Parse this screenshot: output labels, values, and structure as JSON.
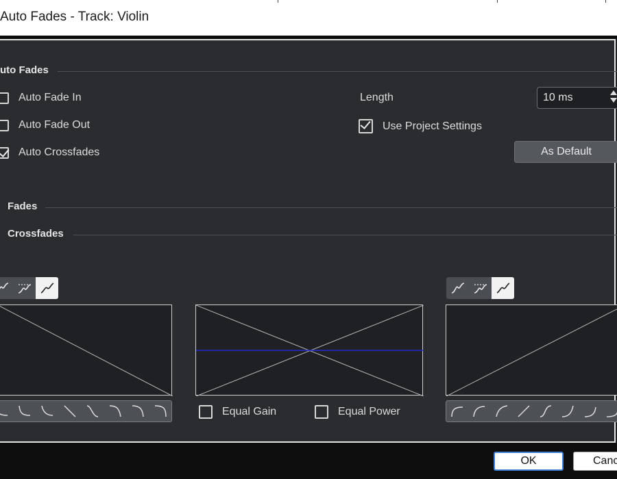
{
  "window": {
    "title": "Auto Fades - Track: Violin"
  },
  "auto_fades": {
    "heading": "uto Fades",
    "fade_in": {
      "label": "Auto Fade In",
      "checked": false
    },
    "fade_out": {
      "label": "Auto Fade Out",
      "checked": false
    },
    "crossfades": {
      "label": "Auto Crossfades",
      "checked": true
    },
    "length_label": "Length",
    "length_value": "10 ms",
    "use_project": {
      "label": "Use Project Settings",
      "checked": true
    },
    "as_default_label": "As Default"
  },
  "sections": {
    "fades": "Fades",
    "crossfades": "Crossfades"
  },
  "crossfade_editor": {
    "equal_gain": {
      "label": "Equal Gain",
      "checked": false
    },
    "equal_power": {
      "label": "Equal Power",
      "checked": false
    },
    "left_icons": [
      "spline-curve-icon",
      "damped-spline-icon",
      "linear-curve-icon"
    ],
    "right_icons": [
      "spline-curve-icon",
      "damped-spline-icon",
      "linear-curve-icon"
    ],
    "active_icon": "linear-curve-icon"
  },
  "footer": {
    "ok_label": "OK",
    "cancel_label": "Canc"
  },
  "colors": {
    "panel_bg": "#2a2c2f",
    "crossfade_line": "#1f2fd0",
    "active_toggle": "#f2f2f2"
  }
}
